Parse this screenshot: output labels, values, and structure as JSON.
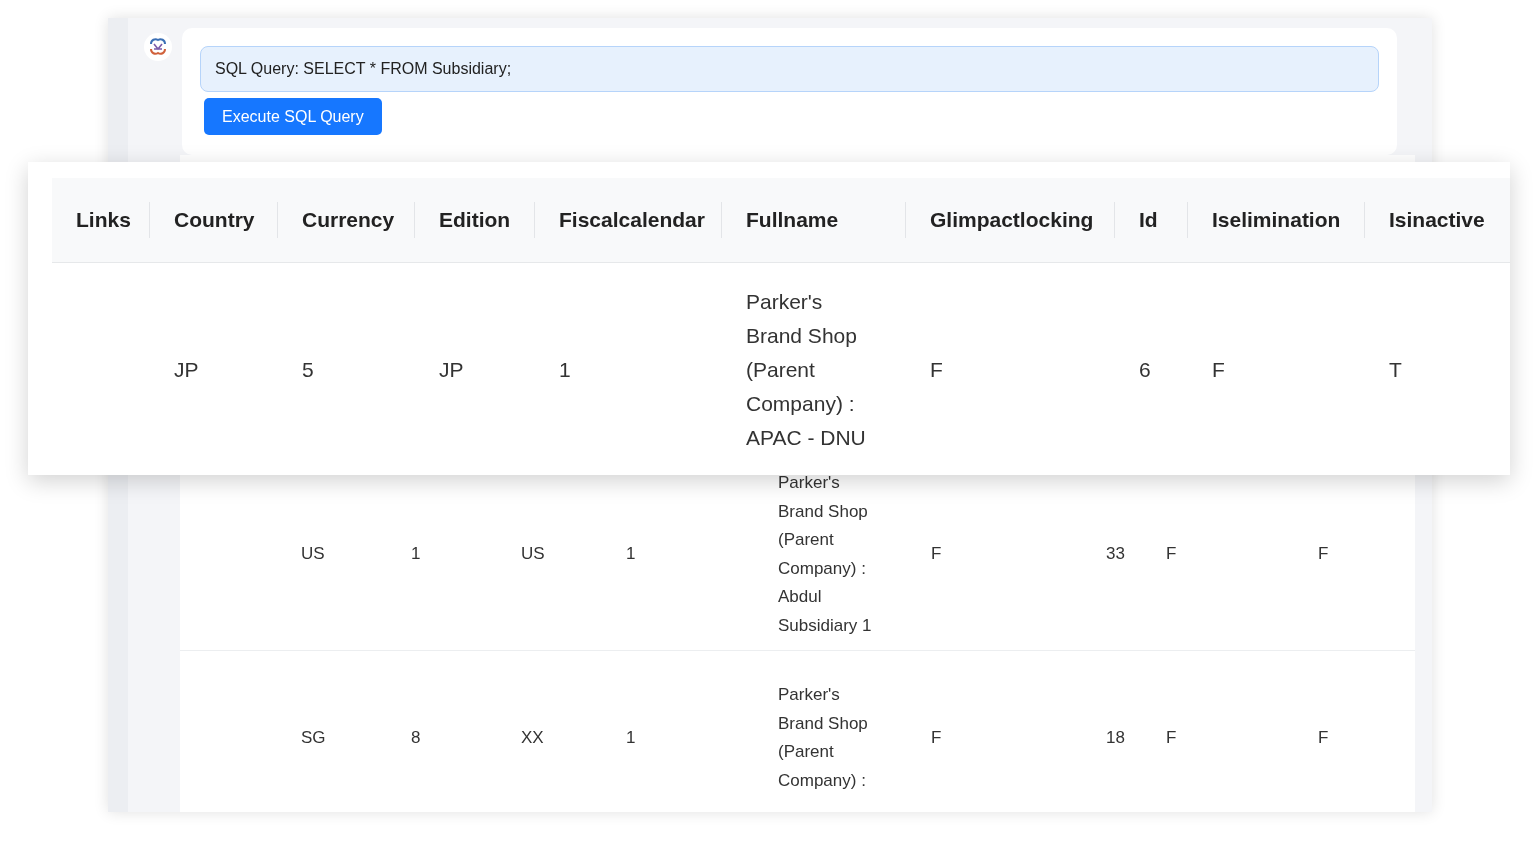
{
  "query_panel": {
    "query_text": "SQL Query: SELECT * FROM Subsidiary;",
    "execute_button": "Execute SQL Query"
  },
  "zoomed_table": {
    "columns": [
      "Links",
      "Country",
      "Currency",
      "Edition",
      "Fiscalcalendar",
      "Fullname",
      "Glimpactlocking",
      "Id",
      "Iselimination",
      "Isinactive"
    ],
    "rows": [
      {
        "cells": [
          "",
          "JP",
          "5",
          "JP",
          "1",
          "Parker's Brand Shop (Parent Company) : APAC - DNU",
          "F",
          "6",
          "F",
          "T"
        ]
      }
    ]
  },
  "background_table": {
    "rows": [
      {
        "cells": [
          "US",
          "1",
          "US",
          "1",
          "Parker's Brand Shop (Parent Company) : Abdul Subsidiary 1",
          "F",
          "33",
          "F",
          "F"
        ]
      },
      {
        "cells": [
          "SG",
          "8",
          "XX",
          "1",
          "Parker's Brand Shop (Parent Company) :",
          "F",
          "18",
          "F",
          "F"
        ]
      }
    ]
  }
}
